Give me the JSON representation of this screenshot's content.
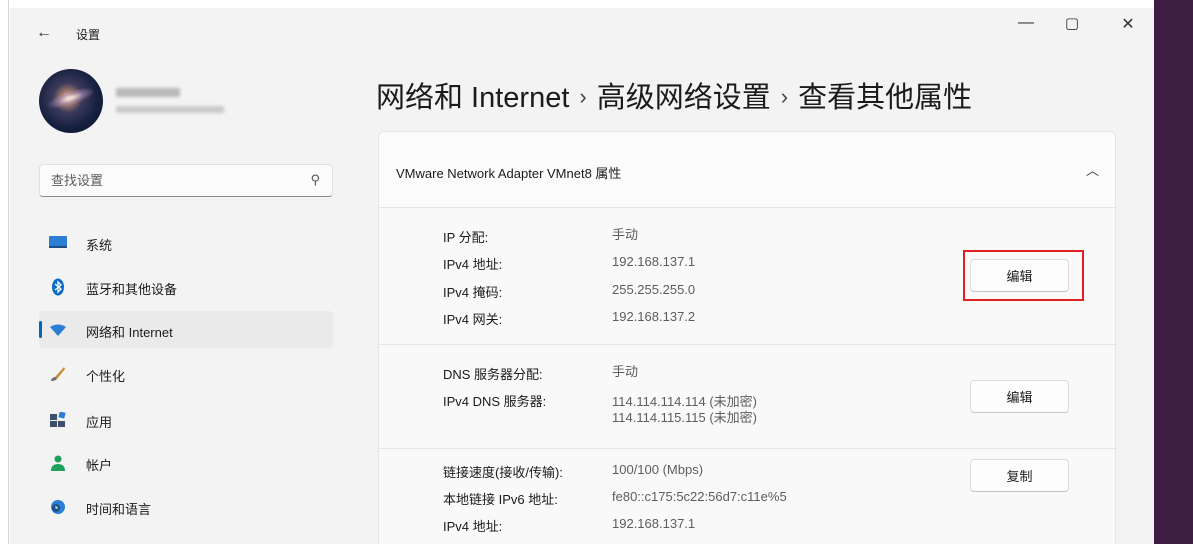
{
  "titlebar": {
    "back_icon": "back-arrow-icon",
    "app_title": "设置",
    "minimize": "—",
    "maximize": "▢",
    "close": "✕"
  },
  "profile": {
    "name": "Falls Bo",
    "email": "a.f.n.fy.jjp.m"
  },
  "search": {
    "placeholder": "查找设置"
  },
  "sidebar": {
    "items": [
      {
        "label": "系统",
        "icon": "monitor-icon"
      },
      {
        "label": "蓝牙和其他设备",
        "icon": "bluetooth-icon"
      },
      {
        "label": "网络和 Internet",
        "icon": "wifi-icon",
        "active": true
      },
      {
        "label": "个性化",
        "icon": "brush-icon"
      },
      {
        "label": "应用",
        "icon": "apps-icon"
      },
      {
        "label": "帐户",
        "icon": "person-icon"
      },
      {
        "label": "时间和语言",
        "icon": "globe-clock-icon"
      }
    ]
  },
  "breadcrumb": {
    "part1": "网络和 Internet",
    "sep": "›",
    "part2": "高级网络设置",
    "part3": "查看其他属性"
  },
  "card": {
    "title": "VMware Network Adapter VMnet8 属性",
    "sections": {
      "ip": {
        "rows": [
          {
            "label": "IP 分配:",
            "value": "手动"
          },
          {
            "label": "IPv4 地址:",
            "value": "192.168.137.1"
          },
          {
            "label": "IPv4 掩码:",
            "value": "255.255.255.0"
          },
          {
            "label": "IPv4 网关:",
            "value": "192.168.137.2"
          }
        ],
        "button": "编辑"
      },
      "dns": {
        "rows": [
          {
            "label": "DNS 服务器分配:",
            "value": "手动"
          },
          {
            "label": "IPv4 DNS 服务器:",
            "value": "114.114.114.114 (未加密)",
            "value2": "114.114.115.115 (未加密)"
          }
        ],
        "button": "编辑"
      },
      "link": {
        "rows": [
          {
            "label": "链接速度(接收/传输):",
            "value": "100/100 (Mbps)"
          },
          {
            "label": "本地链接 IPv6 地址:",
            "value": "fe80::c175:5c22:56d7:c11e%5"
          },
          {
            "label": "IPv4 地址:",
            "value": "192.168.137.1"
          }
        ],
        "button": "复制"
      }
    }
  },
  "colors": {
    "accent": "#0067c0",
    "highlight": "#e02020",
    "background": "#f3f3f3"
  }
}
